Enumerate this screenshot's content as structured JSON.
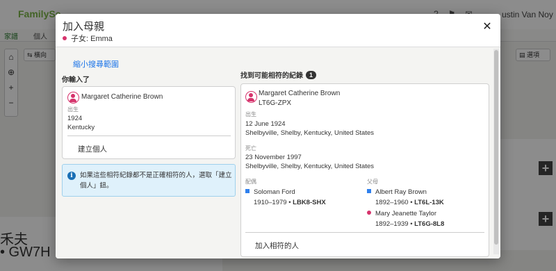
{
  "background": {
    "logo": "FamilySe",
    "user_name": "ustin Van Noy",
    "subnav": [
      "家譜",
      "個人"
    ],
    "orientation_label": "橫向",
    "options_label": "選項",
    "person_name_partial": "禾夫",
    "person_id_partial": "• GW7H"
  },
  "modal": {
    "title": "加入母親",
    "child_label": "子女: Emma",
    "close_icon": "close-icon",
    "narrow_search": "縮小搜尋範圍",
    "you_entered": {
      "heading": "你輸入了",
      "name": "Margaret Catherine Brown",
      "birth_label": "出生",
      "birth_year": "1924",
      "birth_place": "Kentucky",
      "create_person": "建立個人"
    },
    "info": {
      "text": "如果這些相符紀錄都不是正確相符的人，選取「建立個人」鈕。"
    },
    "matches": {
      "heading": "找到可能相符的紀錄",
      "count": "1",
      "name": "Margaret Catherine Brown",
      "pid": "LT6G-ZPX",
      "birth_label": "出生",
      "birth_date": "12 June 1924",
      "birth_place": "Shelbyville, Shelby, Kentucky, United States",
      "death_label": "死亡",
      "death_date": "23 November 1997",
      "death_place": "Shelbyville, Shelby, Kentucky, United States",
      "spouse_label": "配偶",
      "spouse_name": "Soloman Ford",
      "spouse_dates": "1910–1979 • ",
      "spouse_pid": "LBK8-SHX",
      "parents_label": "父母",
      "father_name": "Albert Ray Brown",
      "father_dates": "1892–1960 • ",
      "father_pid": "LT6L-13K",
      "mother_name": "Mary Jeanette Taylor",
      "mother_dates": "1892–1939 • ",
      "mother_pid": "LT6G-8L8",
      "add_match": "加入相符的人"
    }
  },
  "colors": {
    "link": "#1a73e8",
    "female": "#d6336c",
    "male": "#2f80ed",
    "info_bg": "#dff1fb"
  }
}
